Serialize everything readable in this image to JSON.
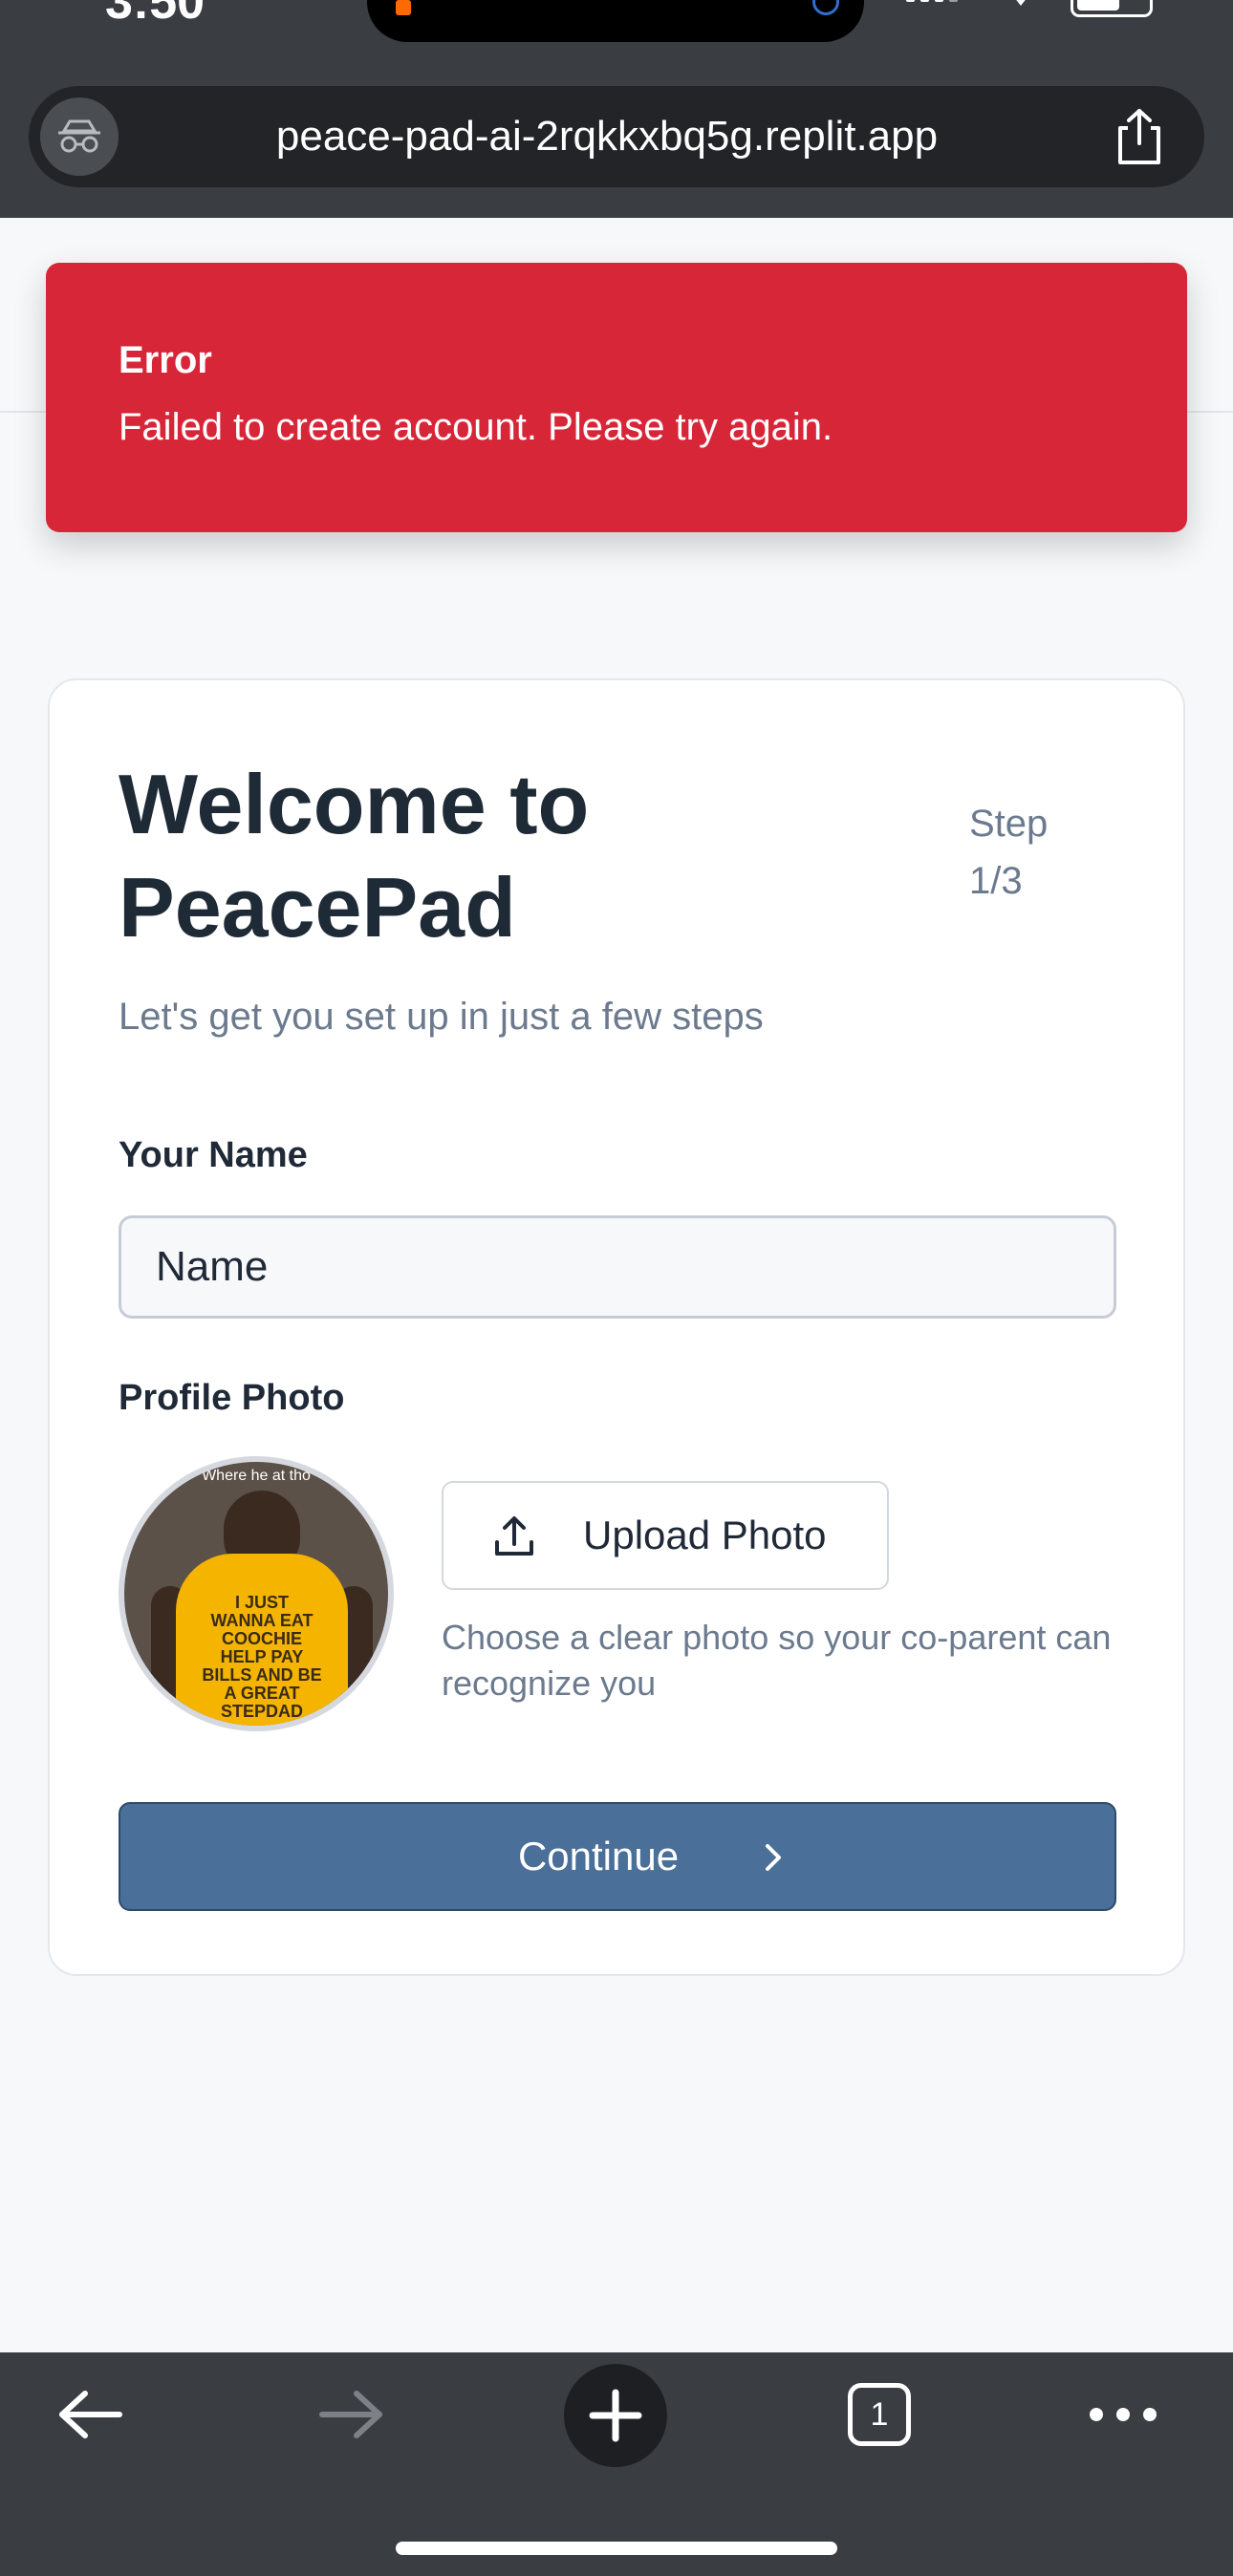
{
  "status_bar": {
    "time": "3:50"
  },
  "browser": {
    "url": "peace-pad-ai-2rqkkxbq5g.replit.app",
    "privacy_icon": "incognito-icon",
    "share_icon": "share-icon"
  },
  "error_toast": {
    "title": "Error",
    "message": "Failed to create account. Please try again."
  },
  "onboarding": {
    "title": "Welcome to PeacePad",
    "step": "Step 1/3",
    "subtitle": "Let's get you set up in just a few steps",
    "name_label": "Your Name",
    "name_placeholder": "Name",
    "photo_label": "Profile Photo",
    "avatar_caption": "Where he at tho",
    "avatar_shirt_text": "I JUST\nWANNA EAT\nCOOCHIE\nHELP PAY\nBILLS AND BE\nA GREAT\nSTEPDAD",
    "upload_button": "Upload Photo",
    "photo_hint": "Choose a clear photo so your co-parent can recognize you",
    "continue_button": "Continue"
  },
  "toolbar": {
    "tab_count": "1",
    "icons": [
      "back-arrow-icon",
      "forward-arrow-icon",
      "plus-icon",
      "tabs-icon",
      "more-icon"
    ]
  },
  "colors": {
    "error": "#d72638",
    "primary": "#4a6f98",
    "chrome": "#3a3d42"
  }
}
